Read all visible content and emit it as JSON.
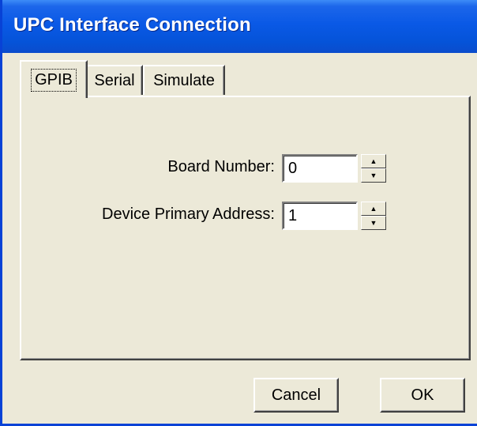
{
  "window": {
    "title": "UPC Interface Connection"
  },
  "tabs": [
    {
      "label": "GPIB",
      "active": true
    },
    {
      "label": "Serial",
      "active": false
    },
    {
      "label": "Simulate",
      "active": false
    }
  ],
  "gpib": {
    "board_number": {
      "label": "Board Number:",
      "value": "0"
    },
    "device_address": {
      "label": "Device Primary Address:",
      "value": "1"
    }
  },
  "spinner": {
    "up_glyph": "▲",
    "down_glyph": "▼"
  },
  "buttons": {
    "cancel_label": "Cancel",
    "ok_label": "OK"
  },
  "colors": {
    "titlebar": "#0a59e6",
    "dialog_face": "#ece9d8",
    "title_text": "#ffffff"
  }
}
